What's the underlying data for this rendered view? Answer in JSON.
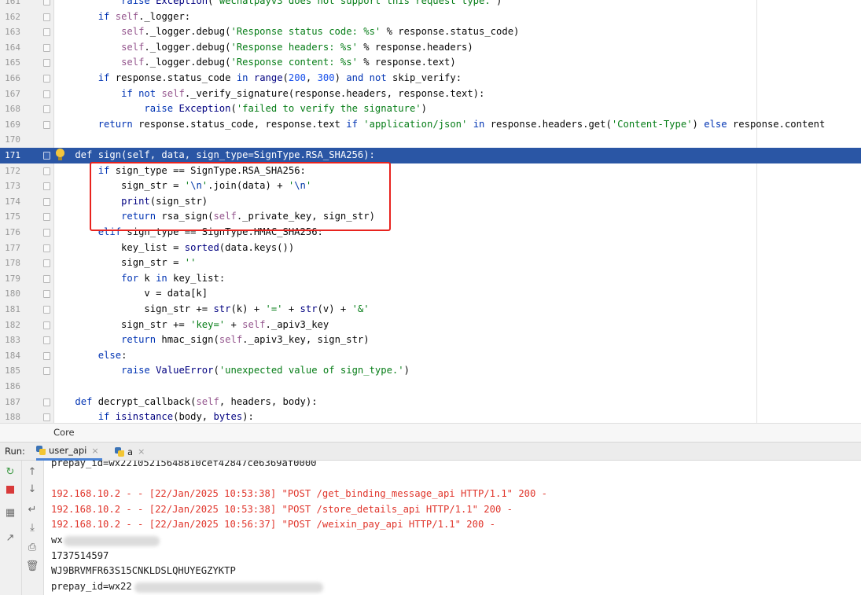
{
  "editor": {
    "lines": [
      {
        "num": "161",
        "text": "            raise Exception('wechatpayv3 does not support this request type.')"
      },
      {
        "num": "162",
        "text": "        if self._logger:"
      },
      {
        "num": "163",
        "text": "            self._logger.debug('Response status code: %s' % response.status_code)"
      },
      {
        "num": "164",
        "text": "            self._logger.debug('Response headers: %s' % response.headers)"
      },
      {
        "num": "165",
        "text": "            self._logger.debug('Response content: %s' % response.text)"
      },
      {
        "num": "166",
        "text": "        if response.status_code in range(200, 300) and not skip_verify:"
      },
      {
        "num": "167",
        "text": "            if not self._verify_signature(response.headers, response.text):"
      },
      {
        "num": "168",
        "text": "                raise Exception('failed to verify the signature')"
      },
      {
        "num": "169",
        "text": "        return response.status_code, response.text if 'application/json' in response.headers.get('Content-Type') else response.content"
      },
      {
        "num": "170",
        "text": ""
      },
      {
        "num": "171",
        "text": "    def sign(self, data, sign_type=SignType.RSA_SHA256):"
      },
      {
        "num": "172",
        "text": "        if sign_type == SignType.RSA_SHA256:"
      },
      {
        "num": "173",
        "text": "            sign_str = '\\n'.join(data) + '\\n'"
      },
      {
        "num": "174",
        "text": "            print(sign_str)"
      },
      {
        "num": "175",
        "text": "            return rsa_sign(self._private_key, sign_str)"
      },
      {
        "num": "176",
        "text": "        elif sign_type == SignType.HMAC_SHA256:"
      },
      {
        "num": "177",
        "text": "            key_list = sorted(data.keys())"
      },
      {
        "num": "178",
        "text": "            sign_str = ''"
      },
      {
        "num": "179",
        "text": "            for k in key_list:"
      },
      {
        "num": "180",
        "text": "                v = data[k]"
      },
      {
        "num": "181",
        "text": "                sign_str += str(k) + '=' + str(v) + '&'"
      },
      {
        "num": "182",
        "text": "            sign_str += 'key=' + self._apiv3_key"
      },
      {
        "num": "183",
        "text": "            return hmac_sign(self._apiv3_key, sign_str)"
      },
      {
        "num": "184",
        "text": "        else:"
      },
      {
        "num": "185",
        "text": "            raise ValueError('unexpected value of sign_type.')"
      },
      {
        "num": "186",
        "text": ""
      },
      {
        "num": "187",
        "text": "    def decrypt_callback(self, headers, body):"
      },
      {
        "num": "188",
        "text": "        if isinstance(body, bytes):"
      }
    ],
    "current_line": "171"
  },
  "breadcrumb": {
    "label": "Core"
  },
  "run": {
    "label": "Run:",
    "tabs": [
      {
        "label": "user_api",
        "close": "×"
      },
      {
        "label": "a",
        "close": "×"
      }
    ]
  },
  "console": {
    "lines": [
      {
        "text": "prepay_id=wx2210521564881​0cef42847ce6369af0000",
        "type": "out"
      },
      {
        "text": "",
        "type": "out"
      },
      {
        "text": "192.168.10.2 - - [22/Jan/2025 10:53:38] \"POST /get_binding_message_api HTTP/1.1\" 200 -",
        "type": "err"
      },
      {
        "text": "192.168.10.2 - - [22/Jan/2025 10:53:38] \"POST /store_details_api HTTP/1.1\" 200 -",
        "type": "err"
      },
      {
        "text": "192.168.10.2 - - [22/Jan/2025 10:56:37] \"POST /weixin_pay_api HTTP/1.1\" 200 -",
        "type": "err"
      },
      {
        "text": "wx",
        "type": "out"
      },
      {
        "text": "1737514597",
        "type": "out"
      },
      {
        "text": "WJ9BRVMFR63S15CNKLDSLQHUYEGZYKTP",
        "type": "out"
      },
      {
        "text": "prepay_id=wx22",
        "type": "out"
      }
    ]
  },
  "icons": {
    "rerun": "rerun-icon",
    "stop": "stop-icon",
    "layout": "layout-icon",
    "pin": "pin-icon",
    "up": "arrow-up-icon",
    "down": "arrow-down-icon",
    "wrap": "soft-wrap-icon",
    "scroll_end": "scroll-to-end-icon",
    "print": "print-icon",
    "trash": "trash-icon"
  },
  "colors": {
    "current_line": "#2a56a5",
    "highlight_box": "#e8231e",
    "error_text": "#e0352b"
  }
}
